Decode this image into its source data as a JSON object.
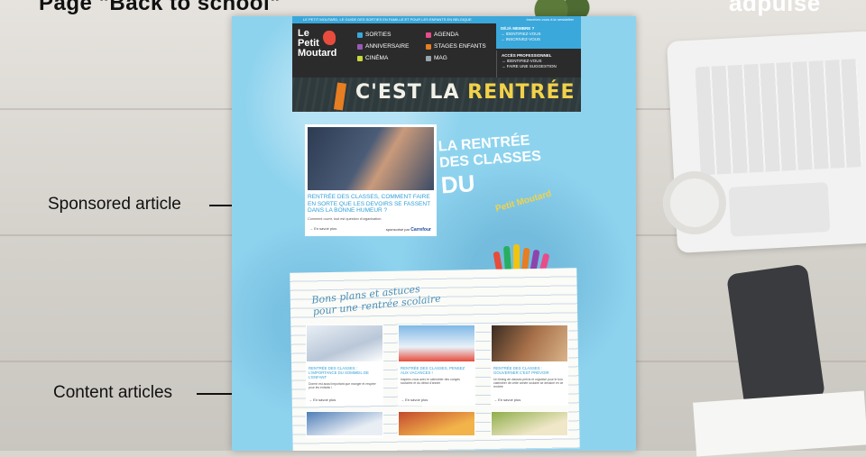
{
  "slide": {
    "title": "Page \"Back to school\"",
    "brand": "adpulse"
  },
  "annotations": {
    "sponsored": "Sponsored article",
    "content": "Content articles"
  },
  "site": {
    "topbar_text": "LE PETIT MOUTARD, LE GUIDE DES SORTIES EN FAMILLE ET POUR LES ENFANTS EN BELGIQUE",
    "topbar_right": "Inscrivez-vous à la newsletter",
    "logo_line1": "Le",
    "logo_line2": "Petit",
    "logo_line3": "Moutard",
    "nav": [
      {
        "label": "SORTIES",
        "icon": "building-icon",
        "color": "#3aa8db"
      },
      {
        "label": "AGENDA",
        "icon": "calendar-icon",
        "color": "#e84c8a"
      },
      {
        "label": "ANNIVERSAIRE",
        "icon": "candle-icon",
        "color": "#9b59b6"
      },
      {
        "label": "STAGES ENFANTS",
        "icon": "pencil-icon",
        "color": "#e67e22"
      },
      {
        "label": "CINÉMA",
        "icon": "popcorn-icon",
        "color": "#c7d840"
      },
      {
        "label": "MAG",
        "icon": "book-icon",
        "color": "#9aa5a9"
      }
    ],
    "member_title": "DÉJÀ MEMBRE ?",
    "member_links": [
      "IDENTIFIEZ-VOUS",
      "INSCRIVEZ-VOUS"
    ],
    "pro_title": "ACCÈS PROFESSIONNEL",
    "pro_links": [
      "IDENTIFIEZ-VOUS",
      "FAIRE UNE SUGGESTION"
    ],
    "banner_text_a": "C'EST LA ",
    "banner_text_b": "RENTRÉE",
    "sponsored_article": {
      "title": "RENTRÉE DES CLASSES, COMMENT FAIRE EN SORTE QUE LES DEVOIRS SE FASSENT DANS LA BONNE HUMEUR ?",
      "excerpt": "Comment ouvrir, tout est question d'organisation.",
      "more": "En savoir plus",
      "sponsor_prefix": "sponsorisé par",
      "sponsor": "Carrefour"
    },
    "rentree_tag": {
      "l1": "LA RENTRÉE",
      "l2": "DES CLASSES",
      "l3": "DU",
      "l4": "Petit Moutard"
    },
    "notebook_headline_1": "Bons plans et astuces",
    "notebook_headline_2": "pour une rentrée scolaire",
    "cards": [
      {
        "title": "RENTRÉE DES CLASSES : L'IMPORTANCE DU SOMMEIL DE L'ENFANT",
        "excerpt": "Dormir est aussi important que manger et respirer pour les enfants !",
        "more": "En savoir plus",
        "img_color": "#b9c7d8"
      },
      {
        "title": "RENTRÉE DES CLASSES, PENSEZ AUX VACANCES !",
        "excerpt": "Inspirez-vous avec le calendrier des congés scolaires et du début d'année",
        "more": "En savoir plus",
        "img_color": "#7fb8e6"
      },
      {
        "title": "RENTRÉE DES CLASSES : GOUVERNER C'EST PRÉVOIR",
        "excerpt": "Un timing de classes précis et organisé pour le bon calendrier de cette année scolaire se dessiné en ce rentrée",
        "more": "En savoir plus",
        "img_color": "#a8714a"
      }
    ],
    "cards_row2_colors": [
      "#4f7fb8",
      "#c24a2e",
      "#8fae4a"
    ]
  }
}
